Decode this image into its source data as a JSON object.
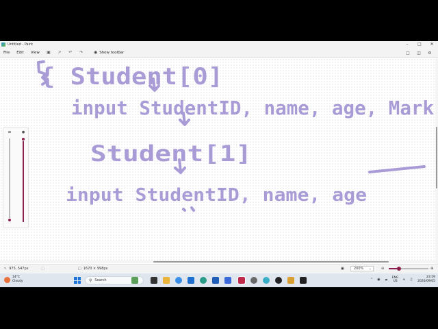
{
  "window": {
    "title": "Untitled - Paint",
    "minimize": "–",
    "maximize": "□",
    "close": "✕"
  },
  "menu": {
    "file": "File",
    "edit": "Edit",
    "view": "View",
    "show_toolbar": "Show toolbar"
  },
  "canvas": {
    "ink_color": "#a99bd6",
    "lines": [
      {
        "text": "{  Student[0]"
      },
      {
        "text": "input StudentID, name, age, Mark"
      },
      {
        "text": "Student[1]"
      },
      {
        "text": "input StudentID, name, age"
      }
    ]
  },
  "status": {
    "cursor_pos": "975, 547px",
    "canvas_size": "1670 × 998px",
    "zoom_level": "200%"
  },
  "taskbar": {
    "weather_temp": "14°C",
    "weather_desc": "Cloudy",
    "search_placeholder": "Search",
    "lang_top": "ENG",
    "lang_bottom": "US",
    "time": "23:59",
    "date": "2026/09/05"
  },
  "colors": {
    "accent": "#8a1f4e",
    "taskbar": "#dfe6ee",
    "start": "#1e73d8"
  }
}
